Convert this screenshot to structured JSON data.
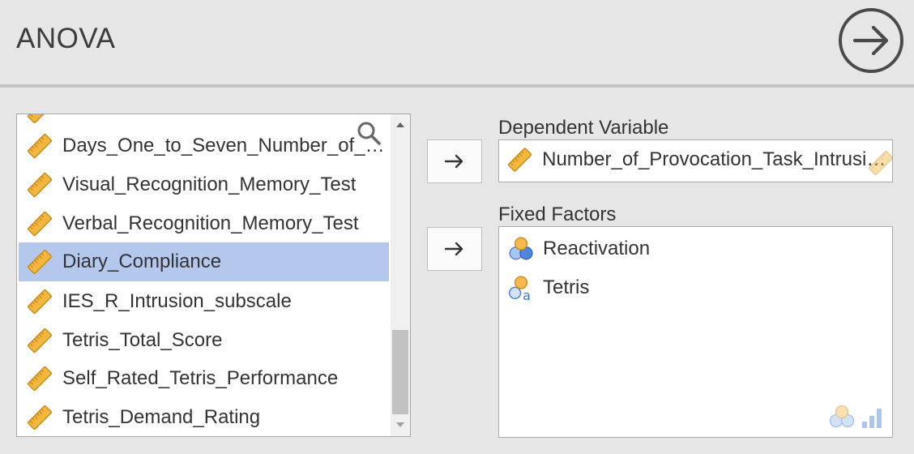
{
  "header": {
    "title": "ANOVA",
    "run_icon": "arrow-right-circle-icon"
  },
  "variables": {
    "search_icon": "magnifier-icon",
    "items": [
      {
        "label": "Days_One_to_Seven_Number_of_I...",
        "type": "continuous",
        "icon": "ruler-icon",
        "selected": false
      },
      {
        "label": "Visual_Recognition_Memory_Test",
        "type": "continuous",
        "icon": "ruler-icon",
        "selected": false
      },
      {
        "label": "Verbal_Recognition_Memory_Test",
        "type": "continuous",
        "icon": "ruler-icon",
        "selected": false
      },
      {
        "label": "Diary_Compliance",
        "type": "continuous",
        "icon": "ruler-icon",
        "selected": true
      },
      {
        "label": "IES_R_Intrusion_subscale",
        "type": "continuous",
        "icon": "ruler-icon",
        "selected": false
      },
      {
        "label": "Tetris_Total_Score",
        "type": "continuous",
        "icon": "ruler-icon",
        "selected": false
      },
      {
        "label": "Self_Rated_Tetris_Performance",
        "type": "continuous",
        "icon": "ruler-icon",
        "selected": false
      },
      {
        "label": "Tetris_Demand_Rating",
        "type": "continuous",
        "icon": "ruler-icon",
        "selected": false
      }
    ]
  },
  "dependent": {
    "label": "Dependent Variable",
    "value": "Number_of_Provocation_Task_Intrusions",
    "move_icon": "arrow-right-icon"
  },
  "fixed_factors": {
    "label": "Fixed Factors",
    "move_icon": "arrow-right-icon",
    "items": [
      {
        "label": "Reactivation",
        "icon": "nominal-factor-icon"
      },
      {
        "label": "Tetris",
        "icon": "nominal-text-factor-icon"
      }
    ]
  },
  "colors": {
    "selection": "#b4c8ee",
    "ruler": "#f2b134",
    "nominal": "#5b8fe0"
  }
}
